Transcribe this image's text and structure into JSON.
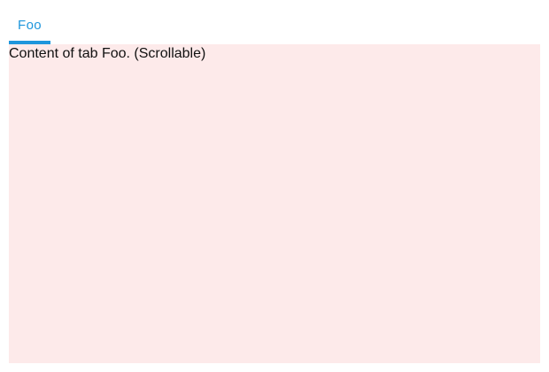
{
  "tabs": [
    {
      "label": "Foo",
      "selected": true
    }
  ],
  "panel": {
    "text": "Content of tab Foo. (Scrollable)"
  },
  "colors": {
    "accent": "#1e96dc",
    "panel_background": "#fdeaea",
    "text": "#111111"
  }
}
